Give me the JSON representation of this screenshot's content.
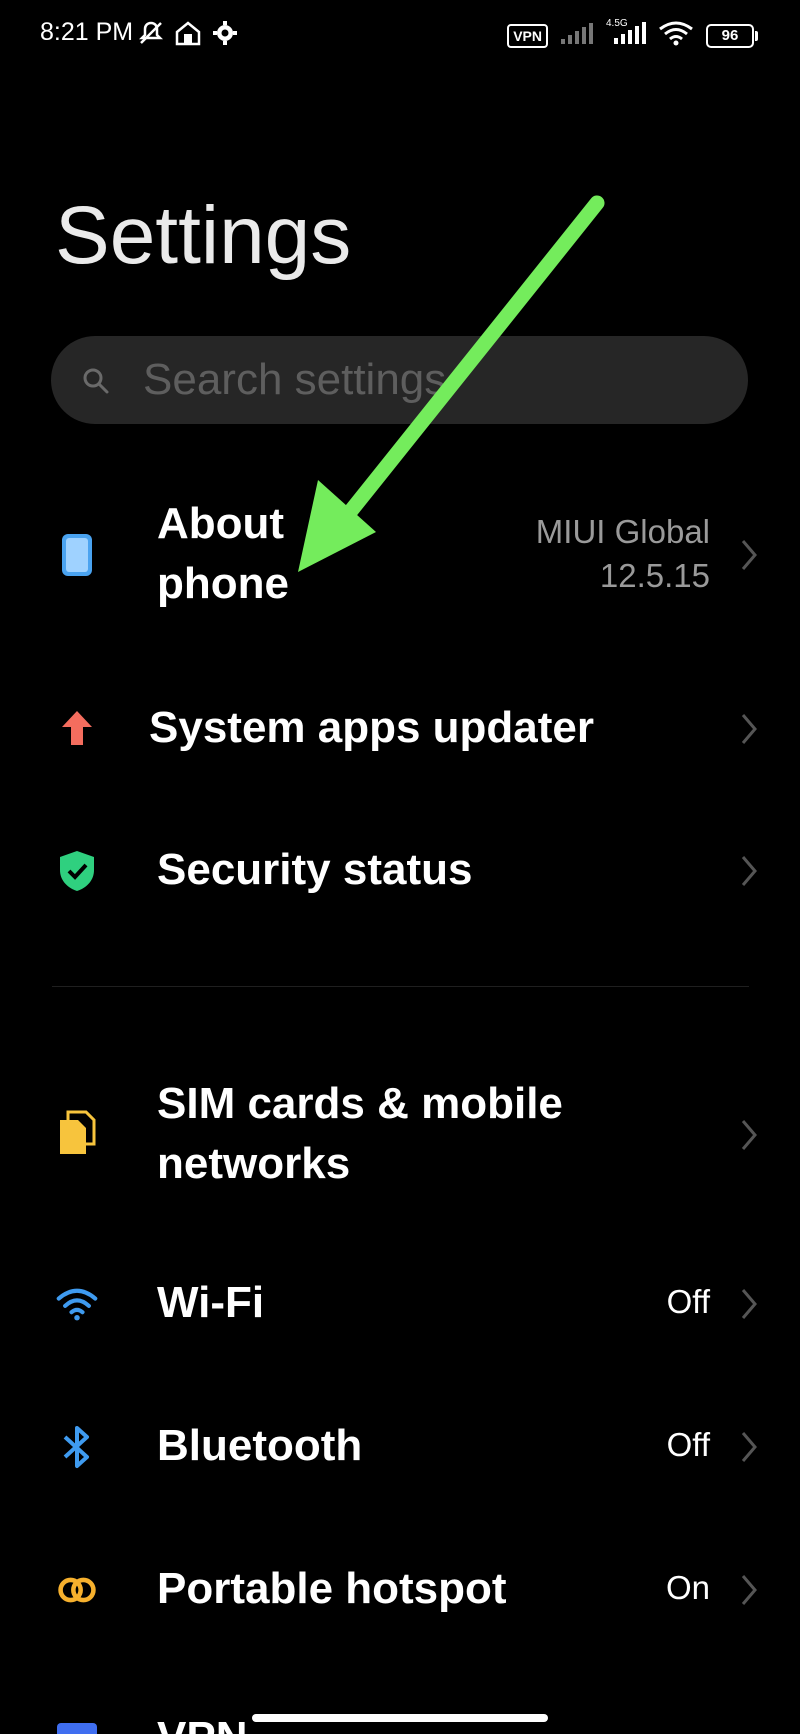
{
  "status_bar": {
    "time": "8:21 PM",
    "vpn_label": "VPN",
    "network_type": "4.5G",
    "battery_level": "96",
    "left_icons": [
      "mute-icon",
      "home-icon",
      "gear-icon"
    ]
  },
  "page": {
    "title": "Settings"
  },
  "search": {
    "placeholder": "Search settings"
  },
  "items": [
    {
      "label": "About\nphone",
      "value": "MIUI Global\n12.5.15",
      "icon": "phone-icon",
      "color": "#4aa3f0"
    },
    {
      "label": "System apps updater",
      "value": "",
      "icon": "arrow-up-icon",
      "color": "#f46d5e"
    },
    {
      "label": "Security status",
      "value": "",
      "icon": "shield-check-icon",
      "color": "#2fd07f"
    },
    {
      "label": "SIM cards & mobile\nnetworks",
      "value": "",
      "icon": "sim-card-icon",
      "color": "#f7c43d"
    },
    {
      "label": "Wi-Fi",
      "value": "Off",
      "icon": "wifi-icon",
      "color": "#3f9bf0"
    },
    {
      "label": "Bluetooth",
      "value": "Off",
      "icon": "bluetooth-icon",
      "color": "#3f9bf0"
    },
    {
      "label": "Portable hotspot",
      "value": "On",
      "icon": "hotspot-icon",
      "color": "#f6b02d"
    },
    {
      "label": "VPN",
      "value": "",
      "icon": "vpn-icon",
      "color": "#3f6ef0"
    }
  ],
  "annotation": {
    "arrow_color": "#74ec5c"
  }
}
